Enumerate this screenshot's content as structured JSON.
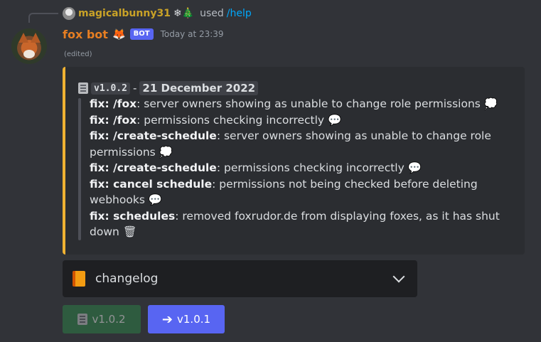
{
  "reply": {
    "username": "magicalbunny31",
    "decorations": "❄🎄",
    "used": "used",
    "command": "/help"
  },
  "message": {
    "username": "fox bot",
    "emoji": "🦊",
    "badge": "BOT",
    "timestamp": "Today at 23:39",
    "edited": "(edited)"
  },
  "embed": {
    "accent_color": "#f0b232",
    "version": "v1.0.2",
    "separator": "-",
    "date": "21 December 2022",
    "notes": [
      {
        "label": "fix: /fox",
        "text": ": server owners showing as unable to change role permissions",
        "emoji": "💭"
      },
      {
        "label": "fix: /fox",
        "text": ": permissions checking incorrectly",
        "emoji": "💬"
      },
      {
        "label": "fix: /create-schedule",
        "text": ": server owners showing as unable to change role permissions",
        "emoji": "💭"
      },
      {
        "label": "fix: /create-schedule",
        "text": ": permissions checking incorrectly",
        "emoji": "💬"
      },
      {
        "label": "fix: cancel schedule",
        "text": ": permissions not being checked before deleting webhooks",
        "emoji": "💬"
      },
      {
        "label": "fix: schedules",
        "text": ": removed foxrudor.de from displaying foxes, as it has shut down",
        "emoji": "🗑"
      }
    ]
  },
  "select": {
    "icon": "orange-book-icon",
    "label": "changelog"
  },
  "buttons": {
    "current": {
      "label": "v1.0.2",
      "icon": "book-icon",
      "disabled": true
    },
    "previous": {
      "label": "v1.0.1",
      "icon": "arrow-right-icon",
      "disabled": false
    }
  }
}
